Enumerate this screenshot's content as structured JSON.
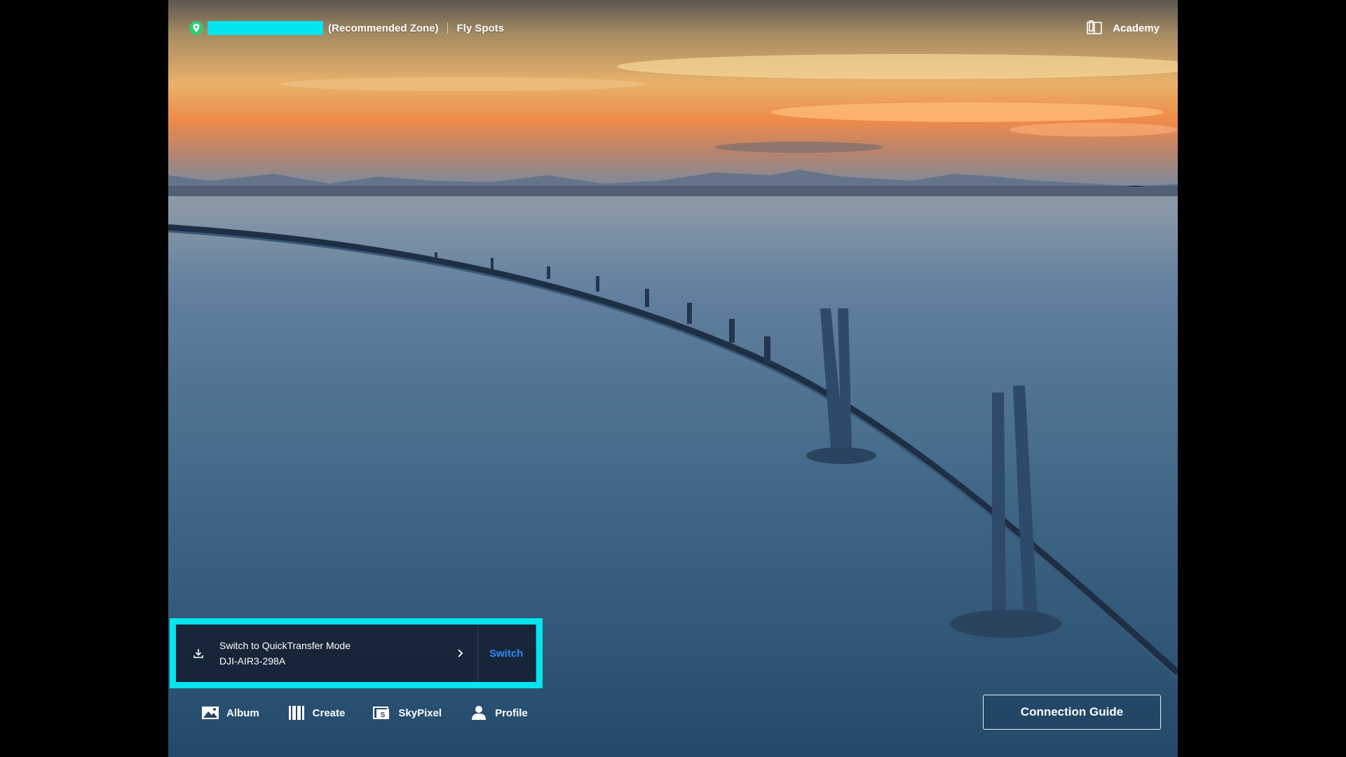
{
  "topbar": {
    "zone_label": "(Recommended Zone)",
    "fly_spots": "Fly Spots",
    "academy": "Academy",
    "location_icon": "location-pin-icon",
    "academy_icon": "book-icon"
  },
  "quicktransfer": {
    "title": "Switch to QuickTransfer Mode",
    "device": "DJI-AIR3-298A",
    "action": "Switch",
    "icon": "download-icon"
  },
  "nav": {
    "items": [
      {
        "label": "Album",
        "icon": "album-icon"
      },
      {
        "label": "Create",
        "icon": "create-icon"
      },
      {
        "label": "SkyPixel",
        "icon": "skypixel-icon"
      },
      {
        "label": "Profile",
        "icon": "profile-icon"
      }
    ]
  },
  "connection_guide": "Connection Guide",
  "colors": {
    "highlight": "#00e5ee",
    "location_green": "#2ecc71",
    "switch_blue": "#2e8bff"
  }
}
